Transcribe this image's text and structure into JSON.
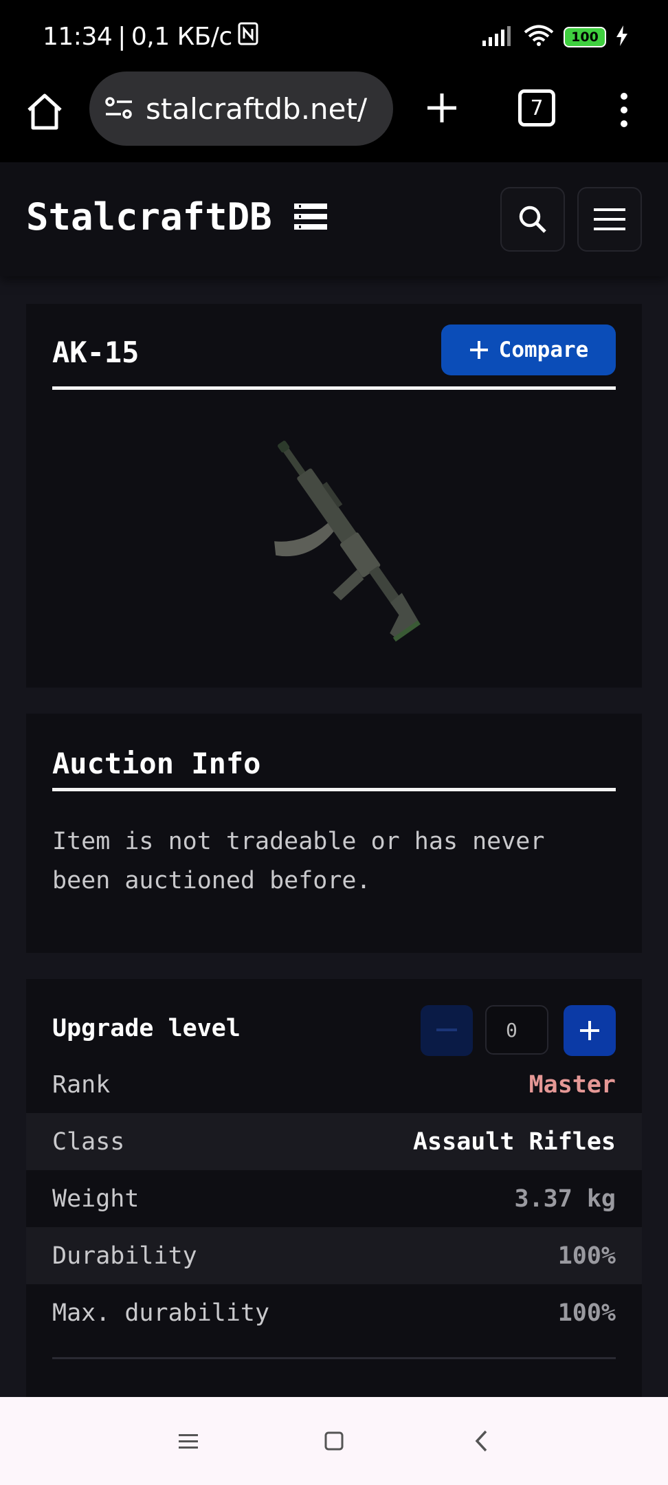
{
  "status_bar": {
    "time": "11:34",
    "separator": "|",
    "network_speed": "0,1 КБ/с",
    "battery": "100"
  },
  "browser": {
    "url": "stalcraftdb.net/",
    "tab_count": "7"
  },
  "site": {
    "logo_text": "StalcraftDB"
  },
  "item_card": {
    "title": "AK-15",
    "compare_label": "Compare"
  },
  "auction": {
    "title": "Auction Info",
    "message": "Item is not tradeable or has never been auctioned before."
  },
  "stats": {
    "upgrade_label": "Upgrade level",
    "upgrade_value": "0",
    "rows": [
      {
        "label": "Rank",
        "value": "Master",
        "color": "#e59896"
      },
      {
        "label": "Class",
        "value": "Assault Rifles",
        "color": "#ffffff"
      },
      {
        "label": "Weight",
        "value": "3.37 kg",
        "color": "#9a9aa0"
      },
      {
        "label": "Durability",
        "value": "100%",
        "color": "#9a9aa0"
      },
      {
        "label": "Max. durability",
        "value": "100%",
        "color": "#9a9aa0"
      }
    ]
  },
  "icons": {
    "home": "home-icon",
    "site_settings": "tune-icon",
    "new_tab": "plus-icon",
    "tabs": "tabs-icon",
    "menu": "more-vert-icon",
    "logo": "list-icon",
    "search": "search-icon",
    "hamburger": "hamburger-icon",
    "nav_menu": "nav-menu-icon",
    "nav_home": "nav-home-icon",
    "nav_back": "nav-back-icon"
  }
}
